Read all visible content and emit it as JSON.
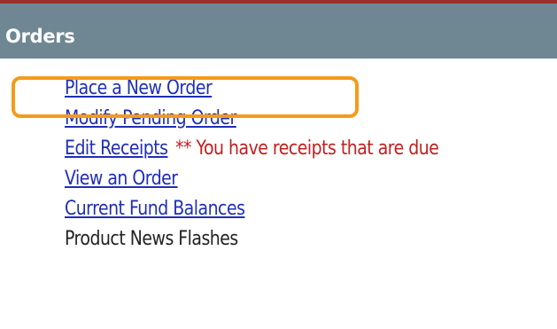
{
  "header": {
    "title": "Orders"
  },
  "orders_menu": {
    "items": [
      {
        "label": "Place a New Order"
      },
      {
        "label": "Modify Pending Order"
      },
      {
        "label": "Edit Receipts",
        "note": "** You have receipts that are due"
      },
      {
        "label": "View an Order"
      },
      {
        "label": "Current Fund Balances"
      },
      {
        "label": "Product News Flashes"
      }
    ]
  },
  "colors": {
    "header_background": "#6f8793",
    "top_border": "#9a2f2f",
    "link": "#1f2fb5",
    "note_text": "#c21f1f",
    "highlight": "#f59a1a"
  }
}
